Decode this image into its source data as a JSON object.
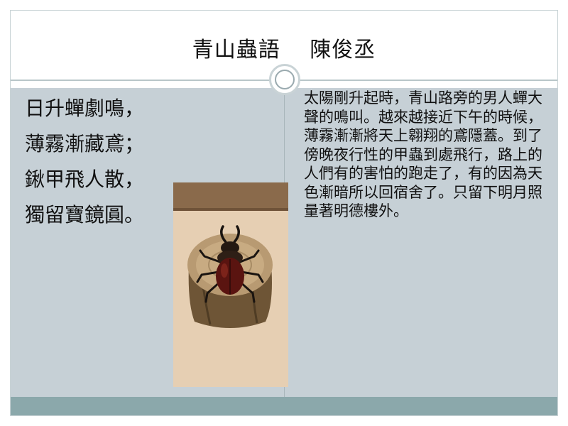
{
  "slide": {
    "title": "青山蟲語　 陳俊丞",
    "poem_lines": [
      "日升蟬劇鳴，",
      "薄霧漸藏鳶；",
      "鍬甲飛人散，",
      "獨留寶鏡圓。"
    ],
    "prose": "太陽剛升起時，青山路旁的男人蟬大聲的鳴叫。越來越接近下午的時候，薄霧漸漸將天上翱翔的鳶隱蓋。到了傍晚夜行性的甲蟲到處飛行，路上的人們有的害怕的跑走了，有的因為天色漸暗所以回宿舍了。只留下明月照量著明德樓外。",
    "photo_icon": "stag-beetle-on-log-photo"
  },
  "colors": {
    "content_band": "#c6d0d6",
    "bottom_bar": "#8ba8ab",
    "rule": "#b9c6c9"
  }
}
